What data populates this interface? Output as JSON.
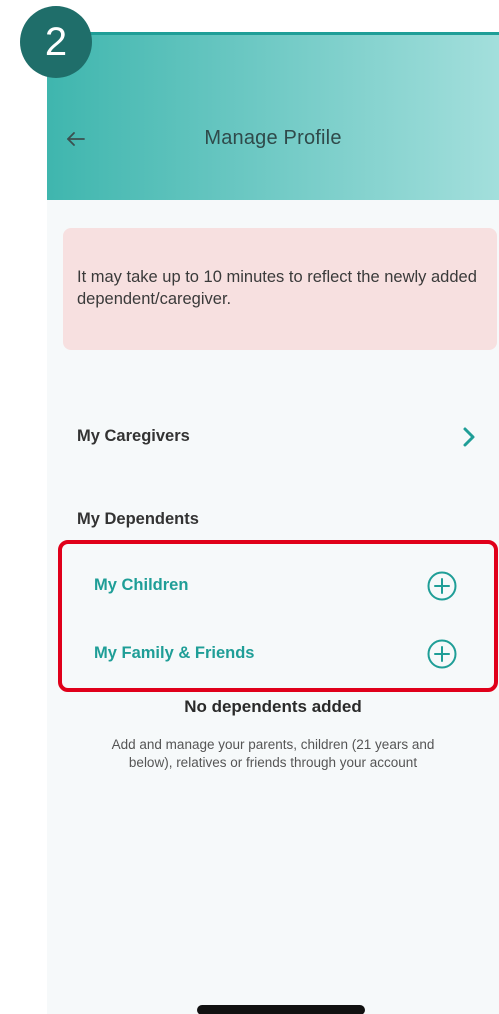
{
  "step_badge": {
    "number": "2"
  },
  "header": {
    "title": "Manage Profile",
    "back_icon": "arrow-left-icon"
  },
  "notice": {
    "text": "It may take up to 10 minutes to reflect the newly added dependent/caregiver."
  },
  "caregivers": {
    "label": "My Caregivers",
    "icon": "chevron-right-icon"
  },
  "dependents": {
    "label": "My Dependents",
    "items": [
      {
        "label": "My Children",
        "icon": "plus-circle-icon"
      },
      {
        "label": "My Family & Friends",
        "icon": "plus-circle-icon"
      }
    ]
  },
  "empty_state": {
    "title": "No dependents added",
    "description": "Add and manage your parents, children (21 years and below), relatives or friends through your account"
  },
  "colors": {
    "accent": "#1f9e97",
    "highlight_border": "#e0001a",
    "notice_bg": "#f7e0e0",
    "badge_bg": "#1f6e6a"
  }
}
